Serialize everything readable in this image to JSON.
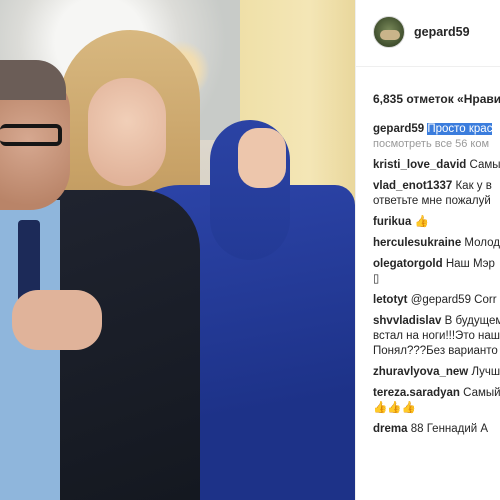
{
  "post": {
    "username": "gepard59",
    "likes_text": "6,835 отметок «Нрави"
  },
  "caption": {
    "username": "gepard59",
    "text": "Просто крас"
  },
  "view_all": "посмотреть все 56 ком",
  "comments": [
    {
      "user": "kristi_love_david",
      "text": "Самы"
    },
    {
      "user": "vlad_enot1337",
      "text": "Как у в",
      "continuation": [
        "ответьте мне пожалуй"
      ]
    },
    {
      "user": "furikua",
      "text": "👍"
    },
    {
      "user": "herculesukraine",
      "text": "Молод"
    },
    {
      "user": "olegatorgold",
      "text": "Наш Мэр",
      "continuation": [
        "▯"
      ]
    },
    {
      "user": "letotyt",
      "text": "@gepard59 Corr"
    },
    {
      "user": "shvvladislav",
      "text": "В будущем",
      "continuation": [
        "встал на ноги!!!Это наш",
        "Понял???Без варианто"
      ]
    },
    {
      "user": "zhuravlyova_new",
      "text": "Лучш"
    },
    {
      "user": "tereza.saradyan",
      "text": "Самый",
      "continuation": [
        "👍👍👍"
      ]
    },
    {
      "user": "drema",
      "text": "88 Геннадий А"
    }
  ]
}
